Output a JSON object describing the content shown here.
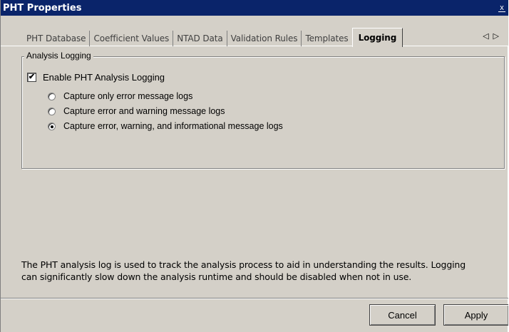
{
  "window": {
    "title": "PHT Properties",
    "close_glyph": "x"
  },
  "tabs": [
    {
      "label": "PHT Database",
      "active": false
    },
    {
      "label": "Coefficient Values",
      "active": false
    },
    {
      "label": "NTAD Data",
      "active": false
    },
    {
      "label": "Validation Rules",
      "active": false
    },
    {
      "label": "Templates",
      "active": false
    },
    {
      "label": "Logging",
      "active": true
    }
  ],
  "tab_scroll": {
    "left": "◁",
    "right": "▷"
  },
  "logging": {
    "group_title": "Analysis Logging",
    "enable_label": "Enable PHT Analysis Logging",
    "enable_checked": true,
    "options": [
      {
        "label": "Capture only error message logs",
        "selected": false
      },
      {
        "label": "Capture error and warning message logs",
        "selected": false
      },
      {
        "label": "Capture error, warning, and informational message logs",
        "selected": true
      }
    ]
  },
  "description": {
    "line1": "The PHT analysis log is used to track the analysis process to aid in understanding the results.  Logging",
    "line2": "can significantly slow down the analysis runtime and should be disabled when not in use."
  },
  "buttons": {
    "cancel": "Cancel",
    "apply": "Apply"
  },
  "check_glyph": "✔"
}
